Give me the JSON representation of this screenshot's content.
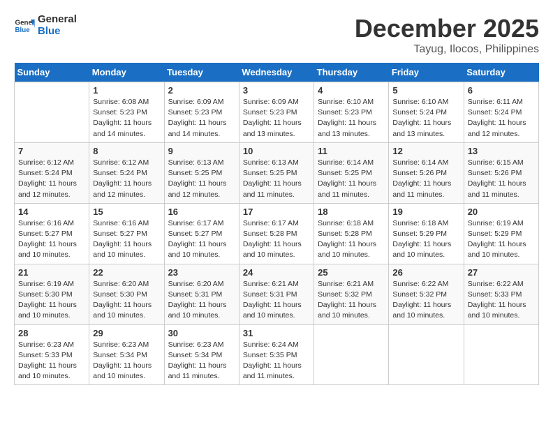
{
  "header": {
    "logo_general": "General",
    "logo_blue": "Blue",
    "month": "December 2025",
    "location": "Tayug, Ilocos, Philippines"
  },
  "days_of_week": [
    "Sunday",
    "Monday",
    "Tuesday",
    "Wednesday",
    "Thursday",
    "Friday",
    "Saturday"
  ],
  "weeks": [
    [
      {
        "day": "",
        "info": ""
      },
      {
        "day": "1",
        "info": "Sunrise: 6:08 AM\nSunset: 5:23 PM\nDaylight: 11 hours\nand 14 minutes."
      },
      {
        "day": "2",
        "info": "Sunrise: 6:09 AM\nSunset: 5:23 PM\nDaylight: 11 hours\nand 14 minutes."
      },
      {
        "day": "3",
        "info": "Sunrise: 6:09 AM\nSunset: 5:23 PM\nDaylight: 11 hours\nand 13 minutes."
      },
      {
        "day": "4",
        "info": "Sunrise: 6:10 AM\nSunset: 5:23 PM\nDaylight: 11 hours\nand 13 minutes."
      },
      {
        "day": "5",
        "info": "Sunrise: 6:10 AM\nSunset: 5:24 PM\nDaylight: 11 hours\nand 13 minutes."
      },
      {
        "day": "6",
        "info": "Sunrise: 6:11 AM\nSunset: 5:24 PM\nDaylight: 11 hours\nand 12 minutes."
      }
    ],
    [
      {
        "day": "7",
        "info": "Sunrise: 6:12 AM\nSunset: 5:24 PM\nDaylight: 11 hours\nand 12 minutes."
      },
      {
        "day": "8",
        "info": "Sunrise: 6:12 AM\nSunset: 5:24 PM\nDaylight: 11 hours\nand 12 minutes."
      },
      {
        "day": "9",
        "info": "Sunrise: 6:13 AM\nSunset: 5:25 PM\nDaylight: 11 hours\nand 12 minutes."
      },
      {
        "day": "10",
        "info": "Sunrise: 6:13 AM\nSunset: 5:25 PM\nDaylight: 11 hours\nand 11 minutes."
      },
      {
        "day": "11",
        "info": "Sunrise: 6:14 AM\nSunset: 5:25 PM\nDaylight: 11 hours\nand 11 minutes."
      },
      {
        "day": "12",
        "info": "Sunrise: 6:14 AM\nSunset: 5:26 PM\nDaylight: 11 hours\nand 11 minutes."
      },
      {
        "day": "13",
        "info": "Sunrise: 6:15 AM\nSunset: 5:26 PM\nDaylight: 11 hours\nand 11 minutes."
      }
    ],
    [
      {
        "day": "14",
        "info": "Sunrise: 6:16 AM\nSunset: 5:27 PM\nDaylight: 11 hours\nand 10 minutes."
      },
      {
        "day": "15",
        "info": "Sunrise: 6:16 AM\nSunset: 5:27 PM\nDaylight: 11 hours\nand 10 minutes."
      },
      {
        "day": "16",
        "info": "Sunrise: 6:17 AM\nSunset: 5:27 PM\nDaylight: 11 hours\nand 10 minutes."
      },
      {
        "day": "17",
        "info": "Sunrise: 6:17 AM\nSunset: 5:28 PM\nDaylight: 11 hours\nand 10 minutes."
      },
      {
        "day": "18",
        "info": "Sunrise: 6:18 AM\nSunset: 5:28 PM\nDaylight: 11 hours\nand 10 minutes."
      },
      {
        "day": "19",
        "info": "Sunrise: 6:18 AM\nSunset: 5:29 PM\nDaylight: 11 hours\nand 10 minutes."
      },
      {
        "day": "20",
        "info": "Sunrise: 6:19 AM\nSunset: 5:29 PM\nDaylight: 11 hours\nand 10 minutes."
      }
    ],
    [
      {
        "day": "21",
        "info": "Sunrise: 6:19 AM\nSunset: 5:30 PM\nDaylight: 11 hours\nand 10 minutes."
      },
      {
        "day": "22",
        "info": "Sunrise: 6:20 AM\nSunset: 5:30 PM\nDaylight: 11 hours\nand 10 minutes."
      },
      {
        "day": "23",
        "info": "Sunrise: 6:20 AM\nSunset: 5:31 PM\nDaylight: 11 hours\nand 10 minutes."
      },
      {
        "day": "24",
        "info": "Sunrise: 6:21 AM\nSunset: 5:31 PM\nDaylight: 11 hours\nand 10 minutes."
      },
      {
        "day": "25",
        "info": "Sunrise: 6:21 AM\nSunset: 5:32 PM\nDaylight: 11 hours\nand 10 minutes."
      },
      {
        "day": "26",
        "info": "Sunrise: 6:22 AM\nSunset: 5:32 PM\nDaylight: 11 hours\nand 10 minutes."
      },
      {
        "day": "27",
        "info": "Sunrise: 6:22 AM\nSunset: 5:33 PM\nDaylight: 11 hours\nand 10 minutes."
      }
    ],
    [
      {
        "day": "28",
        "info": "Sunrise: 6:23 AM\nSunset: 5:33 PM\nDaylight: 11 hours\nand 10 minutes."
      },
      {
        "day": "29",
        "info": "Sunrise: 6:23 AM\nSunset: 5:34 PM\nDaylight: 11 hours\nand 10 minutes."
      },
      {
        "day": "30",
        "info": "Sunrise: 6:23 AM\nSunset: 5:34 PM\nDaylight: 11 hours\nand 11 minutes."
      },
      {
        "day": "31",
        "info": "Sunrise: 6:24 AM\nSunset: 5:35 PM\nDaylight: 11 hours\nand 11 minutes."
      },
      {
        "day": "",
        "info": ""
      },
      {
        "day": "",
        "info": ""
      },
      {
        "day": "",
        "info": ""
      }
    ]
  ]
}
